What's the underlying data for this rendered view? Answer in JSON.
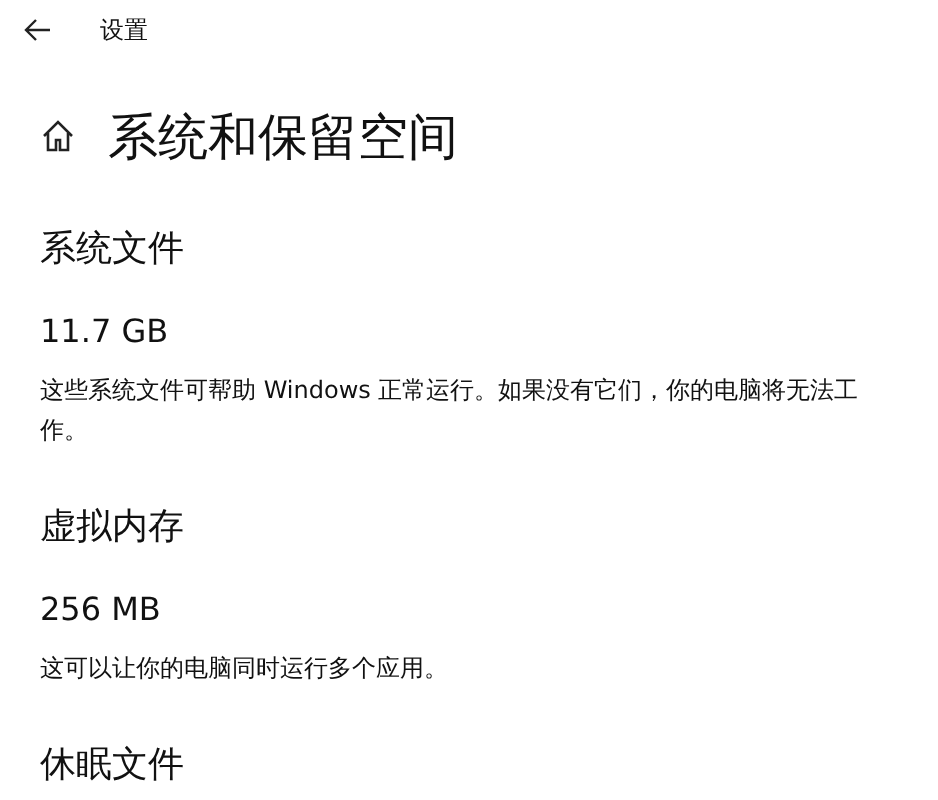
{
  "window": {
    "title": "设置"
  },
  "page": {
    "title": "系统和保留空间"
  },
  "sections": [
    {
      "heading": "系统文件",
      "size": "11.7 GB",
      "description": "这些系统文件可帮助 Windows 正常运行。如果没有它们，你的电脑将无法工作。"
    },
    {
      "heading": "虚拟内存",
      "size": "256 MB",
      "description": "这可以让你的电脑同时运行多个应用。"
    },
    {
      "heading": "休眠文件"
    }
  ]
}
